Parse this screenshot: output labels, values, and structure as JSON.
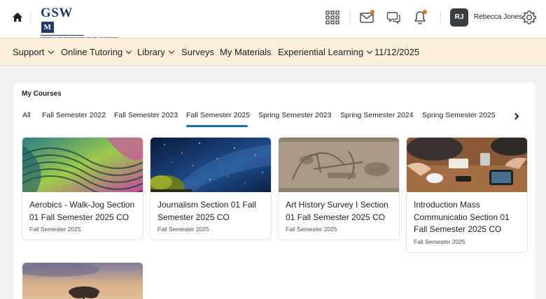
{
  "header": {
    "logo_text": "GSW",
    "logo_badge": "M",
    "logo_subtitle": "GEORGIA SOUTHWESTERN STATE UNIVERSITY",
    "avatar_initials": "RJ",
    "user_name": "Rebecca Jones",
    "accent_color": "#e87511"
  },
  "nav": {
    "items": [
      "Support",
      "Online Tutoring",
      "Library",
      "Surveys",
      "My Materials",
      "Experiential Learning",
      "11/12/2025"
    ]
  },
  "courses_panel": {
    "title": "My Courses",
    "tabs": [
      "All",
      "Fall Semester 2022",
      "Fall Semester 2023",
      "Fall Semester 2025",
      "Spring Semester 2023",
      "Spring Semester 2024",
      "Spring Semester 2025"
    ],
    "active_tab": "Fall Semester 2025",
    "courses": [
      {
        "name": "Aerobics - Walk-Jog Section 01 Fall Semester 2025 CO",
        "semester": "Fall Semester 2025"
      },
      {
        "name": "Journalism Section 01 Fall Semester 2025 CO",
        "semester": "Fall Semester 2025"
      },
      {
        "name": "Art History Survey I Section 01 Fall Semester 2025 CO",
        "semester": "Fall Semester 2025"
      },
      {
        "name": "Introduction Mass Communicatio Section 01 Fall Semester 2025 CO",
        "semester": "Fall Semester 2025"
      }
    ]
  }
}
